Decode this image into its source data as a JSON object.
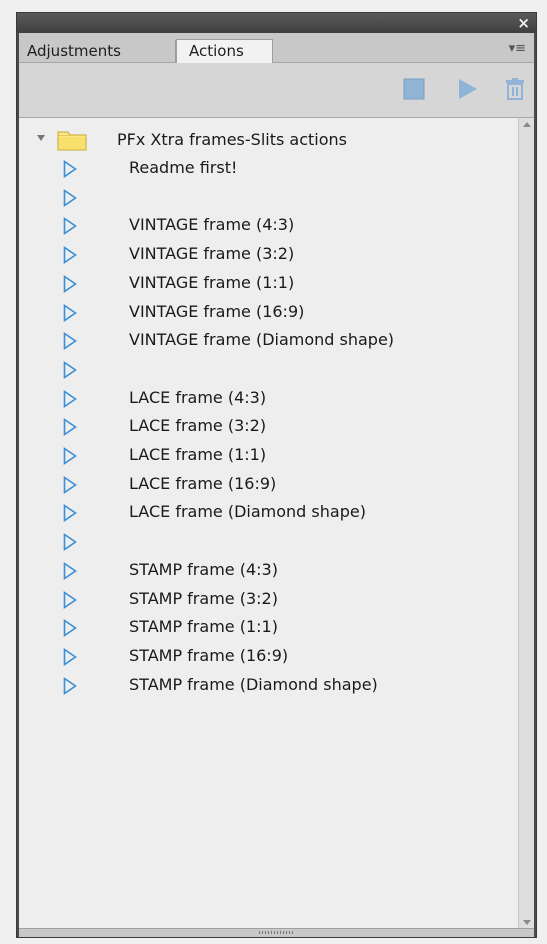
{
  "window": {
    "close_glyph": "×"
  },
  "tabs": [
    {
      "label": "Adjustments",
      "active": false
    },
    {
      "label": "Actions",
      "active": true
    }
  ],
  "panel_menu_glyph": "▾≡",
  "toolbar": {
    "buttons": [
      {
        "name": "stop",
        "icon": "stop-square-icon"
      },
      {
        "name": "play",
        "icon": "play-triangle-icon"
      },
      {
        "name": "delete",
        "icon": "trash-icon"
      }
    ]
  },
  "colors": {
    "accent_blue": "#3b8fd6",
    "folder_yellow": "#f7e06b"
  },
  "actions": {
    "folder": {
      "label": "PFx Xtra frames-Slits actions",
      "expanded": true
    },
    "items": [
      {
        "label": "Readme first!"
      },
      {
        "label": ""
      },
      {
        "label": "VINTAGE frame (4:3)"
      },
      {
        "label": "VINTAGE frame (3:2)"
      },
      {
        "label": "VINTAGE frame (1:1)"
      },
      {
        "label": "VINTAGE frame (16:9)"
      },
      {
        "label": "VINTAGE frame (Diamond shape)"
      },
      {
        "label": ""
      },
      {
        "label": "LACE frame (4:3)"
      },
      {
        "label": "LACE frame (3:2)"
      },
      {
        "label": "LACE frame (1:1)"
      },
      {
        "label": "LACE frame (16:9)"
      },
      {
        "label": "LACE frame (Diamond shape)"
      },
      {
        "label": ""
      },
      {
        "label": "STAMP frame (4:3)"
      },
      {
        "label": "STAMP frame (3:2)"
      },
      {
        "label": "STAMP frame (1:1)"
      },
      {
        "label": "STAMP frame (16:9)"
      },
      {
        "label": "STAMP frame (Diamond shape)"
      }
    ]
  }
}
